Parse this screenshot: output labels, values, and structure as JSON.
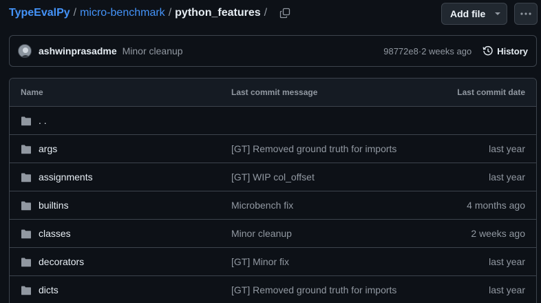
{
  "breadcrumb": {
    "owner": "TypeEvalPy",
    "repo": "micro-benchmark",
    "current": "python_features",
    "separator": "/"
  },
  "actions": {
    "add_file_label": "Add file",
    "more_icon": "kebab-horizontal-icon"
  },
  "commit": {
    "author": "ashwinprasadme",
    "message": "Minor cleanup",
    "sha": "98772e8",
    "time": "2 weeks ago",
    "meta_separator": " · ",
    "history_label": "History"
  },
  "table": {
    "headers": {
      "name": "Name",
      "message": "Last commit message",
      "date": "Last commit date"
    },
    "parent_label": ". .",
    "rows": [
      {
        "name": "args",
        "message": "[GT] Removed ground truth for imports",
        "date": "last year"
      },
      {
        "name": "assignments",
        "message": "[GT] WIP col_offset",
        "date": "last year"
      },
      {
        "name": "builtins",
        "message": "Microbench fix",
        "date": "4 months ago"
      },
      {
        "name": "classes",
        "message": "Minor cleanup",
        "date": "2 weeks ago"
      },
      {
        "name": "decorators",
        "message": "[GT] Minor fix",
        "date": "last year"
      },
      {
        "name": "dicts",
        "message": "[GT] Removed ground truth for imports",
        "date": "last year"
      }
    ]
  },
  "colors": {
    "background": "#0d1117",
    "link": "#4493f8",
    "border": "#3d444d",
    "muted": "#9198a1",
    "folder": "#9198a1"
  }
}
